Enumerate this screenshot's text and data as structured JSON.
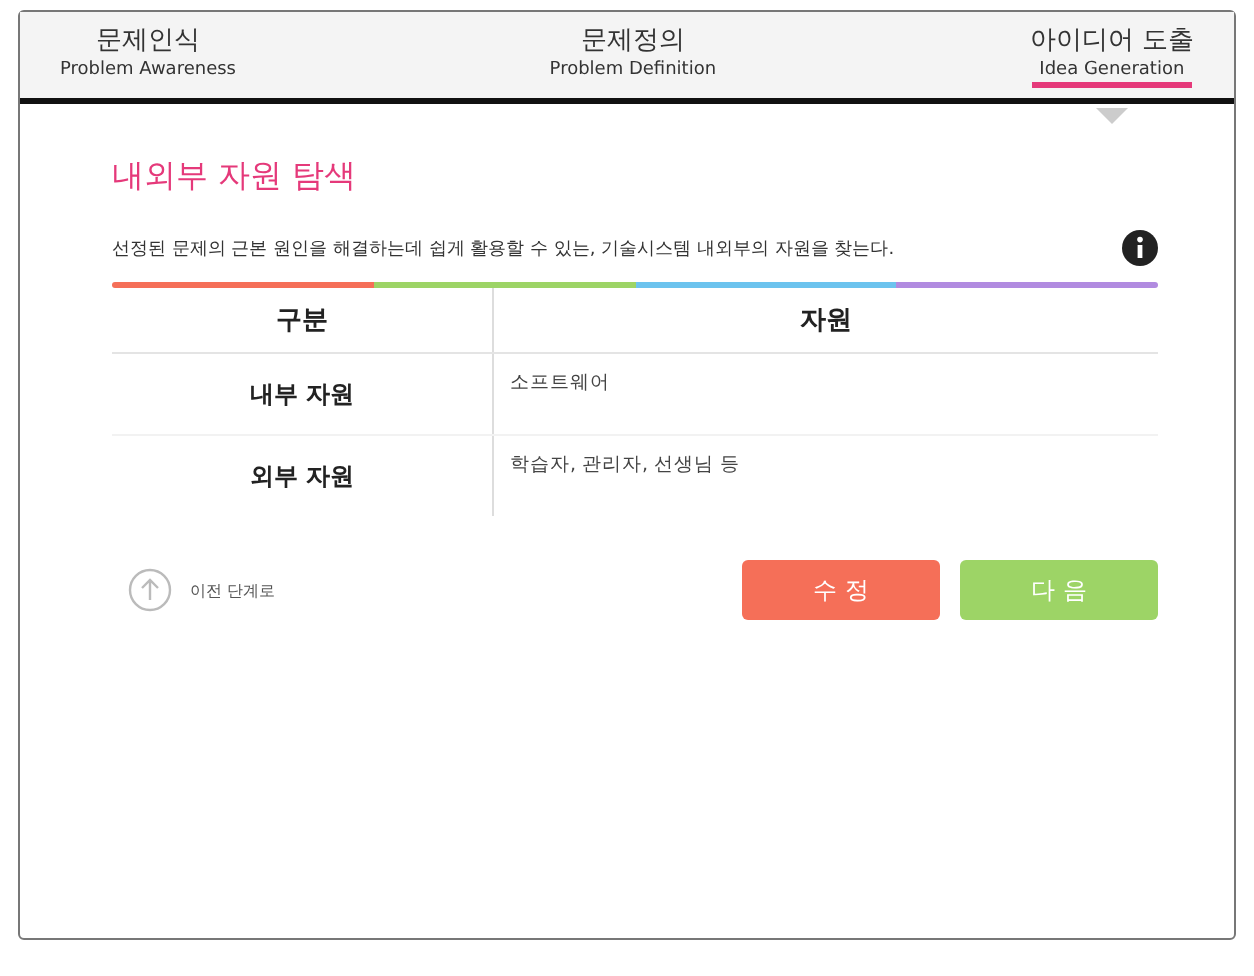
{
  "tabs": [
    {
      "label": "문제인식",
      "sublabel": "Problem Awareness",
      "selected": false
    },
    {
      "label": "문제정의",
      "sublabel": "Problem Definition",
      "selected": false
    },
    {
      "label": "아이디어 도출",
      "sublabel": "Idea Generation",
      "selected": true
    }
  ],
  "section": {
    "title": "내외부 자원 탐색",
    "description": "선정된 문제의 근본 원인을 해결하는데 쉽게 활용할 수 있는, 기술시스템 내외부의 자원을 찾는다."
  },
  "table": {
    "columns": [
      "구분",
      "자원"
    ],
    "rows": [
      {
        "category": "내부 자원",
        "resources": "소프트웨어"
      },
      {
        "category": "외부 자원",
        "resources": "학습자, 관리자, 선생님 등"
      }
    ]
  },
  "back_link": "이전 단계로",
  "buttons": [
    {
      "label": "수 정",
      "color": "#f56f58"
    },
    {
      "label": "다 음",
      "color": "#9dd466"
    }
  ]
}
